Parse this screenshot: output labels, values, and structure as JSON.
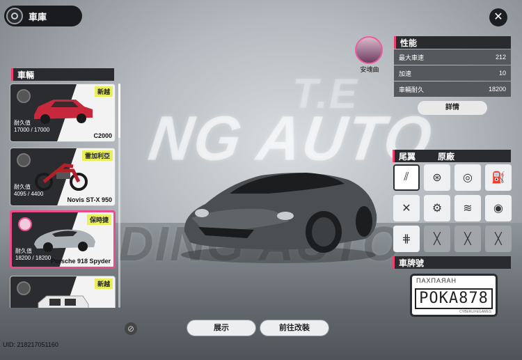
{
  "header": {
    "title": "車庫",
    "close_label": "✕"
  },
  "background": {
    "banner_text": "NG AUTO",
    "banner_text_2": "T.E",
    "floor_text": "DING AUTO"
  },
  "vehicles": {
    "title": "車輛",
    "items": [
      {
        "brand": "新越",
        "durability_label": "耐久值",
        "durability": "17000 / 17000",
        "name": "C2000",
        "color": "#c8283b",
        "selected": false
      },
      {
        "brand": "雷加利亞",
        "durability_label": "耐久值",
        "durability": "4095 / 4400",
        "name": "Novis ST-X 950",
        "color": "#b21f27",
        "selected": false
      },
      {
        "brand": "保時捷",
        "durability_label": "耐久值",
        "durability": "18200 / 18200",
        "name": "Porsche 918 Spyder",
        "color": "#a9b0b6",
        "selected": true
      },
      {
        "brand": "新越",
        "durability_label": "耐久值",
        "durability": "",
        "name": "",
        "color": "#e8e8e8",
        "selected": false
      }
    ]
  },
  "player": {
    "name": "安魂曲"
  },
  "performance": {
    "title": "性能",
    "rows": [
      {
        "label": "最大車速",
        "value": "212"
      },
      {
        "label": "加速",
        "value": "10"
      },
      {
        "label": "車輛耐久",
        "value": "18200"
      }
    ],
    "detail_label": "詳情"
  },
  "parts": {
    "selected_part": "尾翼",
    "status": "原廠",
    "items": [
      {
        "icon": "spoiler-icon",
        "glyph": "⫽",
        "active": true,
        "locked": false
      },
      {
        "icon": "rim-icon",
        "glyph": "⊛",
        "active": false,
        "locked": false
      },
      {
        "icon": "tire-icon",
        "glyph": "◎",
        "active": false,
        "locked": false
      },
      {
        "icon": "nitro-icon",
        "glyph": "⛽",
        "active": false,
        "locked": false
      },
      {
        "icon": "engine-icon",
        "glyph": "✕",
        "active": false,
        "locked": false
      },
      {
        "icon": "gear-icon",
        "glyph": "⚙",
        "active": false,
        "locked": false
      },
      {
        "icon": "suspension-icon",
        "glyph": "≋",
        "active": false,
        "locked": false
      },
      {
        "icon": "brake-icon",
        "glyph": "◉",
        "active": false,
        "locked": false
      },
      {
        "icon": "transmission-icon",
        "glyph": "⋕",
        "active": false,
        "locked": false
      },
      {
        "icon": "locked-slot-icon",
        "glyph": "╳",
        "active": false,
        "locked": true
      },
      {
        "icon": "locked-slot-icon",
        "glyph": "╳",
        "active": false,
        "locked": true
      },
      {
        "icon": "locked-slot-icon",
        "glyph": "╳",
        "active": false,
        "locked": true
      }
    ]
  },
  "plate": {
    "title": "車牌號",
    "top_text": "ПАХПАЯАН",
    "number": "POKA878",
    "small_text": "CYBERLIFEGAMES"
  },
  "footer": {
    "show_label": "展示",
    "modify_label": "前往改裝",
    "uid": "UID: 218217051160"
  },
  "colors": {
    "accent": "#e84c8a",
    "dark": "#2a2b2f",
    "brand_badge": "#e7f05a"
  }
}
